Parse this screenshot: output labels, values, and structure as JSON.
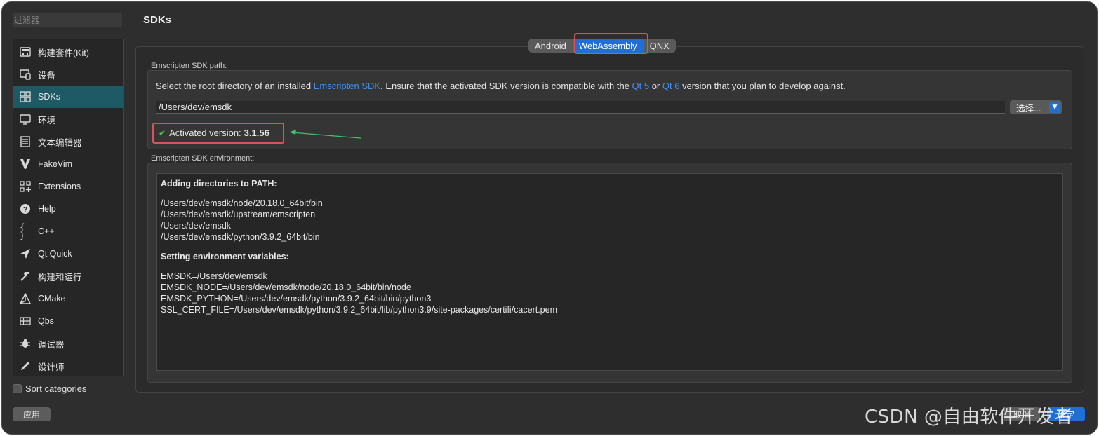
{
  "filter": {
    "placeholder": "过滤器"
  },
  "categories": [
    {
      "label": "构建套件(Kit)",
      "icon": "kit-icon"
    },
    {
      "label": "设备",
      "icon": "device-icon"
    },
    {
      "label": "SDKs",
      "icon": "sdks-icon",
      "selected": true
    },
    {
      "label": "环境",
      "icon": "environment-icon"
    },
    {
      "label": "文本编辑器",
      "icon": "text-editor-icon"
    },
    {
      "label": "FakeVim",
      "icon": "fakevim-icon"
    },
    {
      "label": "Extensions",
      "icon": "extensions-icon"
    },
    {
      "label": "Help",
      "icon": "help-icon"
    },
    {
      "label": "C++",
      "icon": "cpp-icon"
    },
    {
      "label": "Qt Quick",
      "icon": "qt-quick-icon"
    },
    {
      "label": "构建和运行",
      "icon": "build-run-icon"
    },
    {
      "label": "CMake",
      "icon": "cmake-icon"
    },
    {
      "label": "Qbs",
      "icon": "qbs-icon"
    },
    {
      "label": "调试器",
      "icon": "debugger-icon"
    },
    {
      "label": "设计师",
      "icon": "designer-icon"
    }
  ],
  "sort_categories": {
    "label": "Sort categories",
    "checked": false
  },
  "apply_label": "应用",
  "page_title": "SDKs",
  "tabs": [
    {
      "label": "Android",
      "active": false
    },
    {
      "label": "WebAssembly",
      "active": true
    },
    {
      "label": "QNX",
      "active": false
    }
  ],
  "sdk_path": {
    "group_label": "Emscripten SDK path:",
    "desc_1": "Select the root directory of an installed ",
    "link_emscripten": "Emscripten SDK",
    "desc_2": ". Ensure that the activated SDK version is compatible with the ",
    "link_qt5": "Qt 5",
    "desc_3": " or ",
    "link_qt6": "Qt 6",
    "desc_4": " version that you plan to develop against.",
    "value": "/Users/dev/emsdk",
    "choose_label": "选择...",
    "activated_label": "Activated version:",
    "activated_version": "3.1.56"
  },
  "environment": {
    "group_label": "Emscripten SDK environment:",
    "heading_path": "Adding directories to PATH:",
    "path_lines": [
      "/Users/dev/emsdk/node/20.18.0_64bit/bin",
      "/Users/dev/emsdk/upstream/emscripten",
      "/Users/dev/emsdk",
      "/Users/dev/emsdk/python/3.9.2_64bit/bin"
    ],
    "heading_vars": "Setting environment variables:",
    "var_lines": [
      "EMSDK=/Users/dev/emsdk",
      "EMSDK_NODE=/Users/dev/emsdk/node/20.18.0_64bit/bin/node",
      "EMSDK_PYTHON=/Users/dev/emsdk/python/3.9.2_64bit/bin/python3",
      "SSL_CERT_FILE=/Users/dev/emsdk/python/3.9.2_64bit/lib/python3.9/site-packages/certifi/cacert.pem"
    ]
  },
  "footer": {
    "cancel_label": "取消",
    "ok_label": "确定"
  },
  "watermark": "CSDN @自由软件开发者",
  "colors": {
    "accent": "#1f6fd6",
    "selection": "#1e5a66",
    "highlight": "#e0505a",
    "check": "#4cc24c"
  }
}
